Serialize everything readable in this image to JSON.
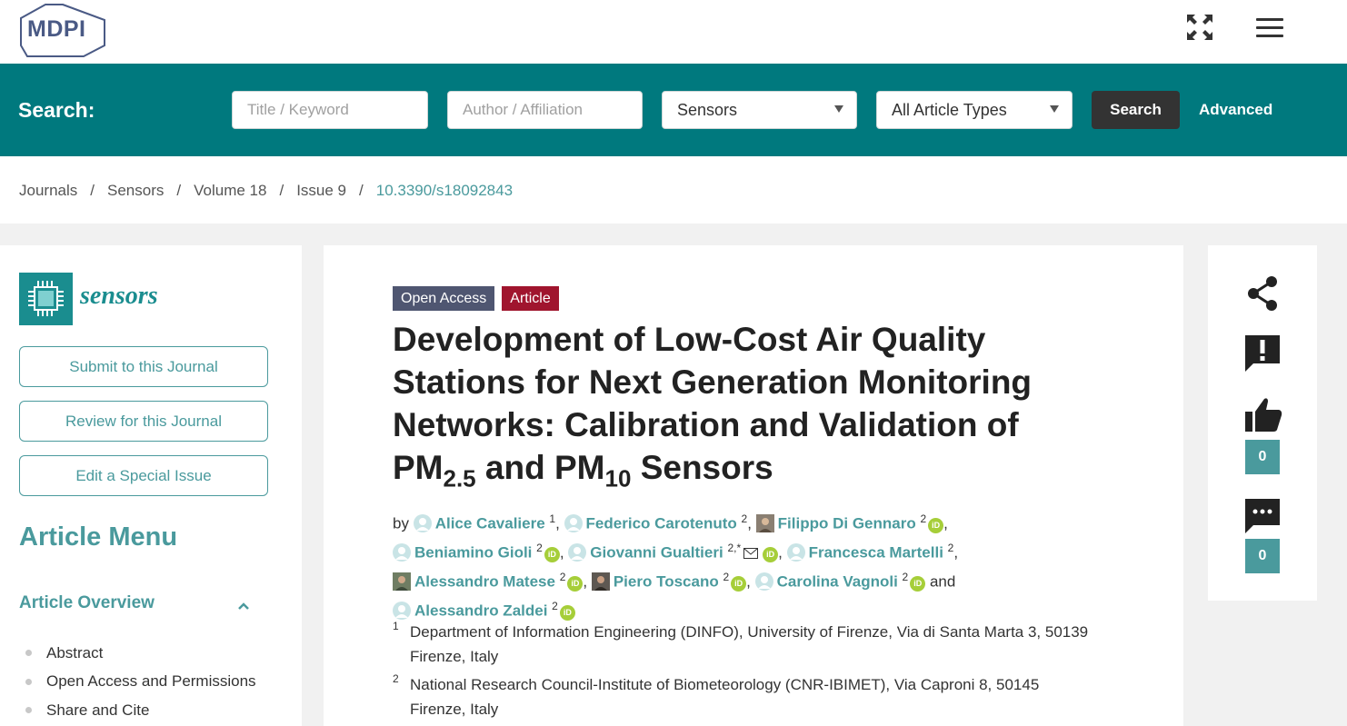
{
  "header": {
    "logo_text": "MDPI"
  },
  "search": {
    "label": "Search:",
    "keyword_placeholder": "Title / Keyword",
    "author_placeholder": "Author / Affiliation",
    "journal_selected": "Sensors",
    "type_selected": "All Article Types",
    "button": "Search",
    "advanced": "Advanced"
  },
  "breadcrumb": [
    "Journals",
    "Sensors",
    "Volume 18",
    "Issue 9",
    "10.3390/s18092843"
  ],
  "sidebar": {
    "journal_name": "sensors",
    "buttons": [
      "Submit to this Journal",
      "Review for this Journal",
      "Edit a Special Issue"
    ],
    "menu_title": "Article Menu",
    "overview_title": "Article Overview",
    "overview_items": [
      "Abstract",
      "Open Access and Permissions",
      "Share and Cite"
    ]
  },
  "article": {
    "badge_open_access": "Open Access",
    "badge_article": "Article",
    "title_line1": "Development of Low-Cost Air Quality",
    "title_line2": "Stations for Next Generation Monitoring",
    "title_line3": "Networks: Calibration and Validation of",
    "title_pm": "PM",
    "title_sub1": "2.5",
    "title_and": " and PM",
    "title_sub2": "10",
    "title_end": " Sensors",
    "by": "by",
    "and": "and",
    "authors": [
      {
        "name": "Alice Cavaliere",
        "aff": "1"
      },
      {
        "name": "Federico Carotenuto",
        "aff": "2"
      },
      {
        "name": "Filippo Di Gennaro",
        "aff": "2"
      },
      {
        "name": "Beniamino Gioli",
        "aff": "2"
      },
      {
        "name": "Giovanni Gualtieri",
        "aff": "2,*"
      },
      {
        "name": "Francesca Martelli",
        "aff": "2"
      },
      {
        "name": "Alessandro Matese",
        "aff": "2"
      },
      {
        "name": "Piero Toscano",
        "aff": "2"
      },
      {
        "name": "Carolina Vagnoli",
        "aff": "2"
      },
      {
        "name": "Alessandro Zaldei",
        "aff": "2"
      }
    ],
    "affiliations": [
      {
        "num": "1",
        "text": "Department of Information Engineering (DINFO), University of Firenze, Via di Santa Marta 3, 50139 Firenze, Italy"
      },
      {
        "num": "2",
        "text": "National Research Council-Institute of Biometeorology (CNR-IBIMET), Via Caproni 8, 50145 Firenze, Italy"
      }
    ]
  },
  "rail": {
    "like_count": "0",
    "comment_count": "0"
  },
  "colors": {
    "teal": "#00797e",
    "link": "#4a9a9d",
    "orcid": "#a6ce39",
    "article_badge": "#a0152e",
    "oa_badge": "#4f5671"
  }
}
